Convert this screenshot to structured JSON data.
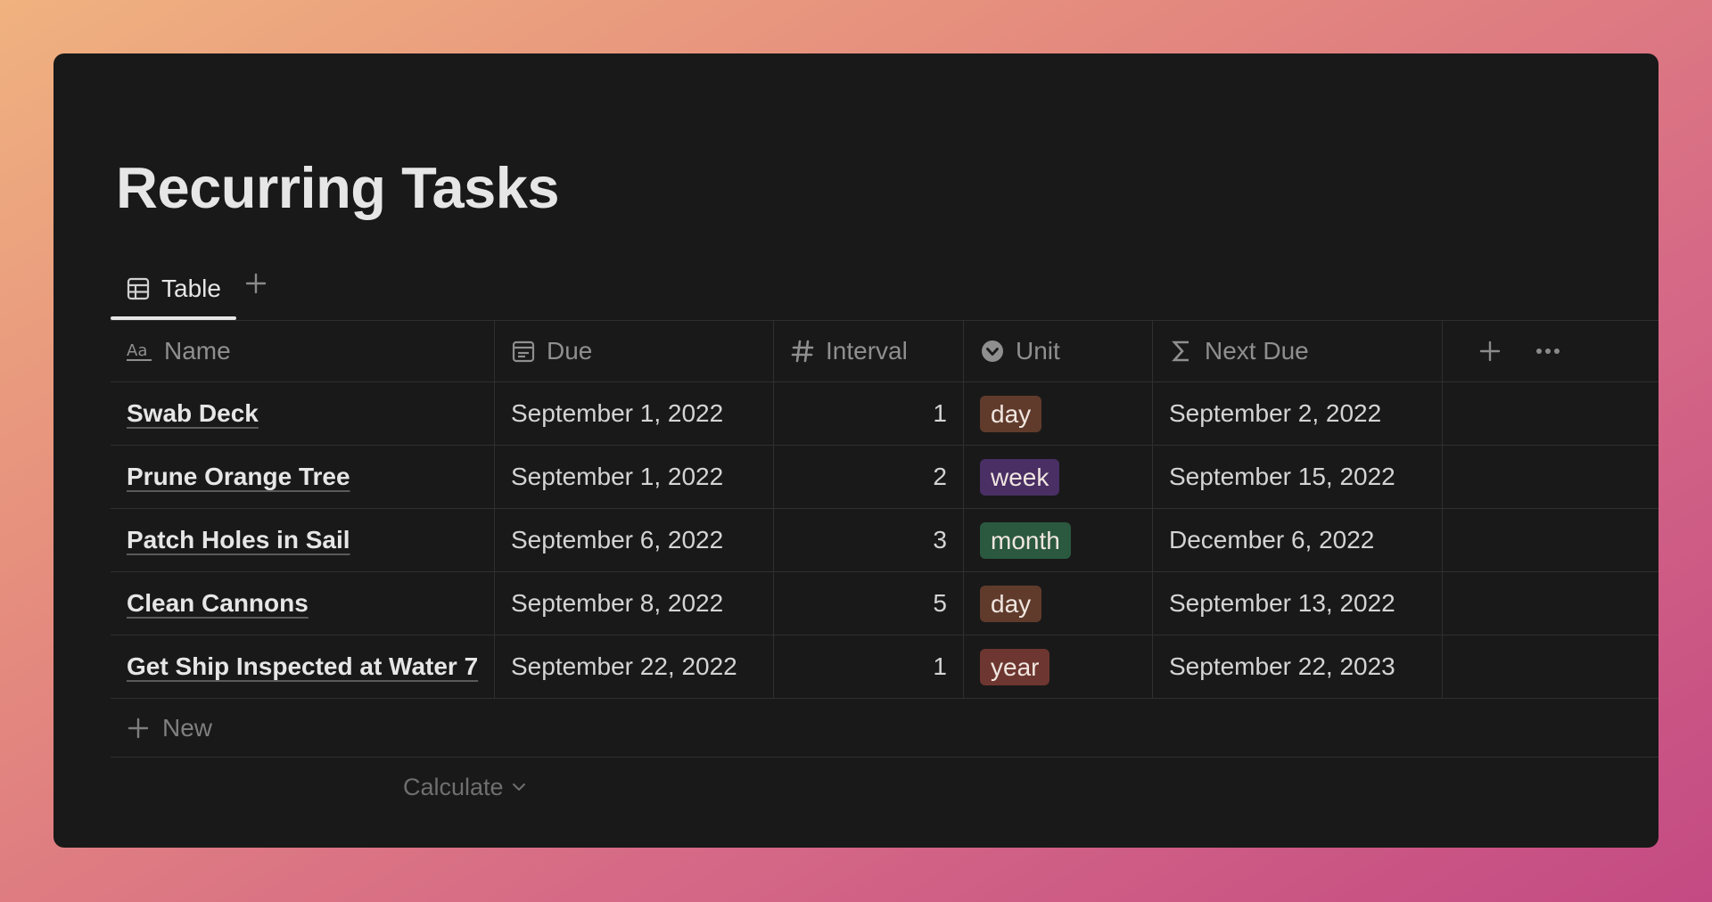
{
  "page": {
    "title": "Recurring Tasks"
  },
  "views": {
    "active_tab_label": "Table",
    "tab_icon": "table-icon",
    "add_icon": "plus-icon"
  },
  "table": {
    "columns": [
      {
        "label": "Name",
        "icon": "text-property-icon"
      },
      {
        "label": "Due",
        "icon": "calendar-icon"
      },
      {
        "label": "Interval",
        "icon": "number-icon"
      },
      {
        "label": "Unit",
        "icon": "select-icon"
      },
      {
        "label": "Next Due",
        "icon": "formula-icon"
      }
    ],
    "rows": [
      {
        "name": "Swab Deck",
        "due": "September 1, 2022",
        "interval": "1",
        "unit": "day",
        "next_due": "September 2, 2022"
      },
      {
        "name": "Prune Orange Tree",
        "due": "September 1, 2022",
        "interval": "2",
        "unit": "week",
        "next_due": "September 15, 2022"
      },
      {
        "name": "Patch Holes in Sail",
        "due": "September 6, 2022",
        "interval": "3",
        "unit": "month",
        "next_due": "December 6, 2022"
      },
      {
        "name": "Clean Cannons",
        "due": "September 8, 2022",
        "interval": "5",
        "unit": "day",
        "next_due": "September 13, 2022"
      },
      {
        "name": "Get Ship Inspected at Water 7",
        "due": "September 22, 2022",
        "interval": "1",
        "unit": "year",
        "next_due": "September 22, 2023"
      }
    ],
    "unit_colors": {
      "day": "#603b2c",
      "week": "#492f64",
      "month": "#2b593f",
      "year": "#6e3630"
    },
    "new_row_label": "New",
    "calculate_label": "Calculate"
  },
  "colors": {
    "window_bg": "#191919",
    "text_primary": "#e6e6e6",
    "text_muted": "#8f8f8f",
    "border": "#2f2f2f"
  }
}
